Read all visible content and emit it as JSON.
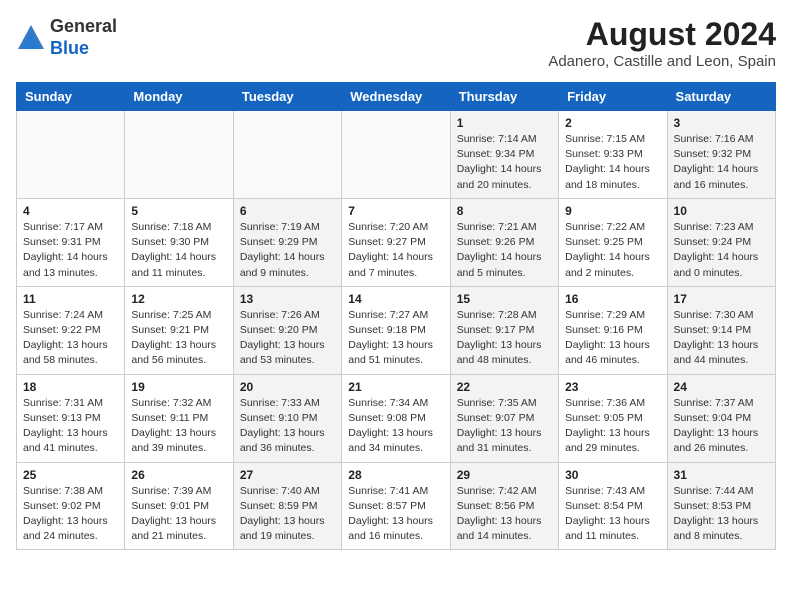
{
  "header": {
    "logo_general": "General",
    "logo_blue": "Blue",
    "month_year": "August 2024",
    "location": "Adanero, Castille and Leon, Spain"
  },
  "weekdays": [
    "Sunday",
    "Monday",
    "Tuesday",
    "Wednesday",
    "Thursday",
    "Friday",
    "Saturday"
  ],
  "weeks": [
    [
      {
        "day": "",
        "info": ""
      },
      {
        "day": "",
        "info": ""
      },
      {
        "day": "",
        "info": ""
      },
      {
        "day": "",
        "info": ""
      },
      {
        "day": "1",
        "info": "Sunrise: 7:14 AM\nSunset: 9:34 PM\nDaylight: 14 hours\nand 20 minutes."
      },
      {
        "day": "2",
        "info": "Sunrise: 7:15 AM\nSunset: 9:33 PM\nDaylight: 14 hours\nand 18 minutes."
      },
      {
        "day": "3",
        "info": "Sunrise: 7:16 AM\nSunset: 9:32 PM\nDaylight: 14 hours\nand 16 minutes."
      }
    ],
    [
      {
        "day": "4",
        "info": "Sunrise: 7:17 AM\nSunset: 9:31 PM\nDaylight: 14 hours\nand 13 minutes."
      },
      {
        "day": "5",
        "info": "Sunrise: 7:18 AM\nSunset: 9:30 PM\nDaylight: 14 hours\nand 11 minutes."
      },
      {
        "day": "6",
        "info": "Sunrise: 7:19 AM\nSunset: 9:29 PM\nDaylight: 14 hours\nand 9 minutes."
      },
      {
        "day": "7",
        "info": "Sunrise: 7:20 AM\nSunset: 9:27 PM\nDaylight: 14 hours\nand 7 minutes."
      },
      {
        "day": "8",
        "info": "Sunrise: 7:21 AM\nSunset: 9:26 PM\nDaylight: 14 hours\nand 5 minutes."
      },
      {
        "day": "9",
        "info": "Sunrise: 7:22 AM\nSunset: 9:25 PM\nDaylight: 14 hours\nand 2 minutes."
      },
      {
        "day": "10",
        "info": "Sunrise: 7:23 AM\nSunset: 9:24 PM\nDaylight: 14 hours\nand 0 minutes."
      }
    ],
    [
      {
        "day": "11",
        "info": "Sunrise: 7:24 AM\nSunset: 9:22 PM\nDaylight: 13 hours\nand 58 minutes."
      },
      {
        "day": "12",
        "info": "Sunrise: 7:25 AM\nSunset: 9:21 PM\nDaylight: 13 hours\nand 56 minutes."
      },
      {
        "day": "13",
        "info": "Sunrise: 7:26 AM\nSunset: 9:20 PM\nDaylight: 13 hours\nand 53 minutes."
      },
      {
        "day": "14",
        "info": "Sunrise: 7:27 AM\nSunset: 9:18 PM\nDaylight: 13 hours\nand 51 minutes."
      },
      {
        "day": "15",
        "info": "Sunrise: 7:28 AM\nSunset: 9:17 PM\nDaylight: 13 hours\nand 48 minutes."
      },
      {
        "day": "16",
        "info": "Sunrise: 7:29 AM\nSunset: 9:16 PM\nDaylight: 13 hours\nand 46 minutes."
      },
      {
        "day": "17",
        "info": "Sunrise: 7:30 AM\nSunset: 9:14 PM\nDaylight: 13 hours\nand 44 minutes."
      }
    ],
    [
      {
        "day": "18",
        "info": "Sunrise: 7:31 AM\nSunset: 9:13 PM\nDaylight: 13 hours\nand 41 minutes."
      },
      {
        "day": "19",
        "info": "Sunrise: 7:32 AM\nSunset: 9:11 PM\nDaylight: 13 hours\nand 39 minutes."
      },
      {
        "day": "20",
        "info": "Sunrise: 7:33 AM\nSunset: 9:10 PM\nDaylight: 13 hours\nand 36 minutes."
      },
      {
        "day": "21",
        "info": "Sunrise: 7:34 AM\nSunset: 9:08 PM\nDaylight: 13 hours\nand 34 minutes."
      },
      {
        "day": "22",
        "info": "Sunrise: 7:35 AM\nSunset: 9:07 PM\nDaylight: 13 hours\nand 31 minutes."
      },
      {
        "day": "23",
        "info": "Sunrise: 7:36 AM\nSunset: 9:05 PM\nDaylight: 13 hours\nand 29 minutes."
      },
      {
        "day": "24",
        "info": "Sunrise: 7:37 AM\nSunset: 9:04 PM\nDaylight: 13 hours\nand 26 minutes."
      }
    ],
    [
      {
        "day": "25",
        "info": "Sunrise: 7:38 AM\nSunset: 9:02 PM\nDaylight: 13 hours\nand 24 minutes."
      },
      {
        "day": "26",
        "info": "Sunrise: 7:39 AM\nSunset: 9:01 PM\nDaylight: 13 hours\nand 21 minutes."
      },
      {
        "day": "27",
        "info": "Sunrise: 7:40 AM\nSunset: 8:59 PM\nDaylight: 13 hours\nand 19 minutes."
      },
      {
        "day": "28",
        "info": "Sunrise: 7:41 AM\nSunset: 8:57 PM\nDaylight: 13 hours\nand 16 minutes."
      },
      {
        "day": "29",
        "info": "Sunrise: 7:42 AM\nSunset: 8:56 PM\nDaylight: 13 hours\nand 14 minutes."
      },
      {
        "day": "30",
        "info": "Sunrise: 7:43 AM\nSunset: 8:54 PM\nDaylight: 13 hours\nand 11 minutes."
      },
      {
        "day": "31",
        "info": "Sunrise: 7:44 AM\nSunset: 8:53 PM\nDaylight: 13 hours\nand 8 minutes."
      }
    ]
  ]
}
